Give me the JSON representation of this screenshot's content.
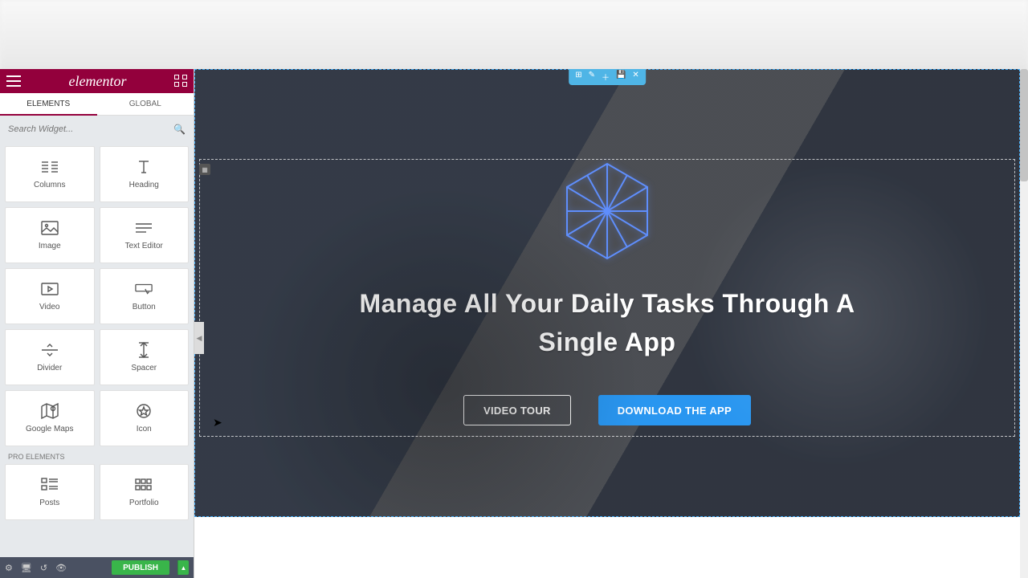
{
  "brand": "elementor",
  "tabs": {
    "elements": "ELEMENTS",
    "global": "GLOBAL"
  },
  "search": {
    "placeholder": "Search Widget..."
  },
  "widgets_basic": [
    {
      "id": "columns",
      "label": "Columns"
    },
    {
      "id": "heading",
      "label": "Heading"
    },
    {
      "id": "image",
      "label": "Image"
    },
    {
      "id": "text-editor",
      "label": "Text Editor"
    },
    {
      "id": "video",
      "label": "Video"
    },
    {
      "id": "button",
      "label": "Button"
    },
    {
      "id": "divider",
      "label": "Divider"
    },
    {
      "id": "spacer",
      "label": "Spacer"
    },
    {
      "id": "google-maps",
      "label": "Google Maps"
    },
    {
      "id": "icon",
      "label": "Icon"
    }
  ],
  "section_pro_label": "PRO ELEMENTS",
  "widgets_pro": [
    {
      "id": "posts",
      "label": "Posts"
    },
    {
      "id": "portfolio",
      "label": "Portfolio"
    }
  ],
  "footer": {
    "publish": "PUBLISH"
  },
  "hero": {
    "heading": "Manage All Your Daily Tasks Through A Single App",
    "btn_outline": "VIDEO TOUR",
    "btn_primary": "DOWNLOAD THE APP"
  },
  "colors": {
    "brand": "#93003c",
    "accent": "#2996f0",
    "publish": "#39b54a",
    "selection": "#4fb5e6"
  }
}
